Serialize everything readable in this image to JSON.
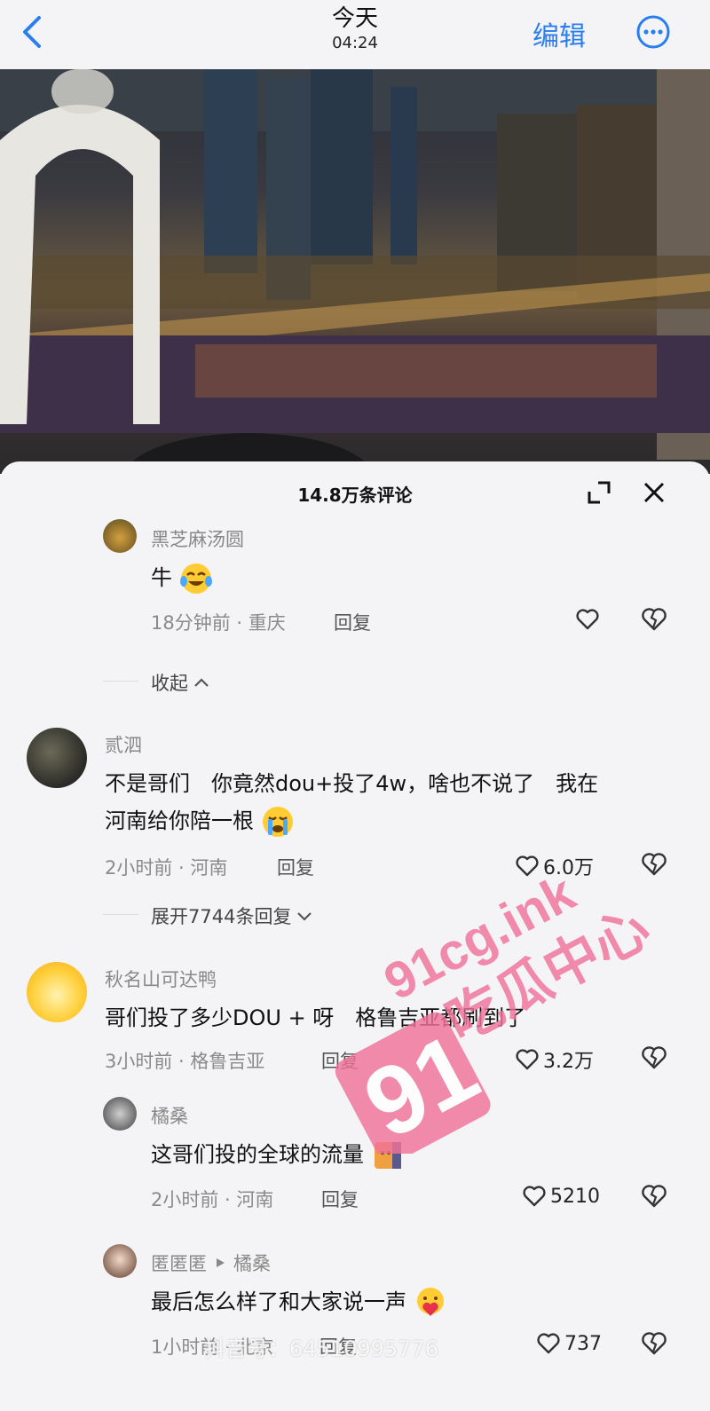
{
  "header": {
    "title": "今天",
    "time": "04:24",
    "edit_label": "编辑"
  },
  "comments_panel": {
    "title": "14.8万条评论"
  },
  "comments": [
    {
      "user": "黑芝麻汤圆",
      "text": "牛",
      "time": "18分钟前",
      "location": "重庆",
      "reply_label": "回复"
    },
    {
      "collapse_label": "收起"
    },
    {
      "user": "贰泗",
      "text_line1": "不是哥们　你竟然dou+投了4w，啥也不说了　我在",
      "text_line2": "河南给你陪一根",
      "time": "2小时前",
      "location": "河南",
      "reply_label": "回复",
      "likes": "6.0万",
      "expand_label": "展开7744条回复"
    },
    {
      "user": "秋名山可达鸭",
      "text": "哥们投了多少DOU + 呀　格鲁吉亚都刷到了",
      "time": "3小时前",
      "location": "格鲁吉亚",
      "reply_label": "回复",
      "likes": "3.2万"
    },
    {
      "user": "橘桑",
      "text": "这哥们投的全球的流量",
      "time": "2小时前",
      "location": "河南",
      "reply_label": "回复",
      "likes": "5210"
    },
    {
      "user": "匿匿匿",
      "reply_to": "橘桑",
      "text": "最后怎么样了和大家说一声",
      "time": "1小时前",
      "location": "北京",
      "reply_label": "回复",
      "likes": "737"
    }
  ],
  "watermark": {
    "brand": "91cg.ink",
    "label": "吃瓜中心",
    "number": "91",
    "account": "抖音号：64510995776"
  },
  "colors": {
    "accent": "#2a7ef0",
    "watermark_pink": "#f0729a"
  }
}
